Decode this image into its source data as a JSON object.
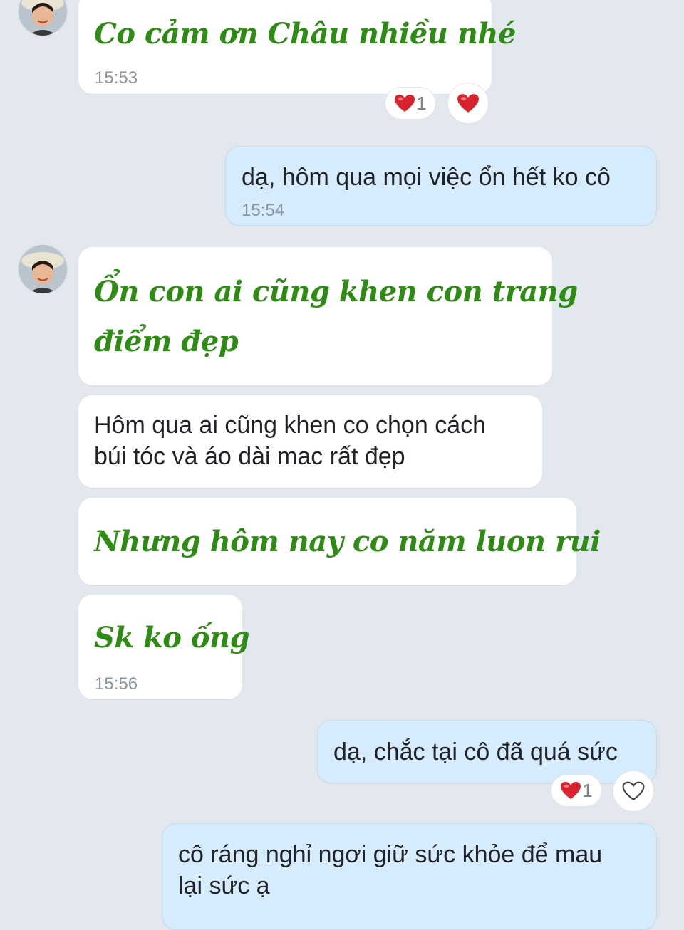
{
  "messages": {
    "m1": {
      "text": "Co cảm ơn Châu nhiều nhé",
      "time": "15:53",
      "reaction_count": "1"
    },
    "m2": {
      "text": "dạ, hôm qua mọi việc ổn hết ko cô",
      "time": "15:54"
    },
    "m3": {
      "line1": "Ổn con ai cũng khen con trang",
      "line2": "điểm đẹp"
    },
    "m4": {
      "line1": "Hôm qua ai cũng khen co chọn cách",
      "line2": "búi tóc và áo dài mac rất đẹp"
    },
    "m5": {
      "text": "Nhưng hôm nay co năm luon rui"
    },
    "m6": {
      "text": "Sk ko ống",
      "time": "15:56"
    },
    "m7": {
      "text": "dạ, chắc tại cô đã quá sức",
      "reaction_count": "1"
    },
    "m8": {
      "line1": "cô ráng nghỉ ngơi giữ sức khỏe để mau",
      "line2": "lại sức ạ"
    }
  },
  "colors": {
    "background": "#e3e8ef",
    "incoming_bubble": "#ffffff",
    "outgoing_bubble": "#d6ebfb",
    "script_text": "#2e8b14",
    "heart": "#d9232e"
  },
  "icons": {
    "reaction": "red-heart-icon",
    "add_reaction_filled": "heart-icon",
    "add_reaction_outline": "heart-outline-icon"
  }
}
